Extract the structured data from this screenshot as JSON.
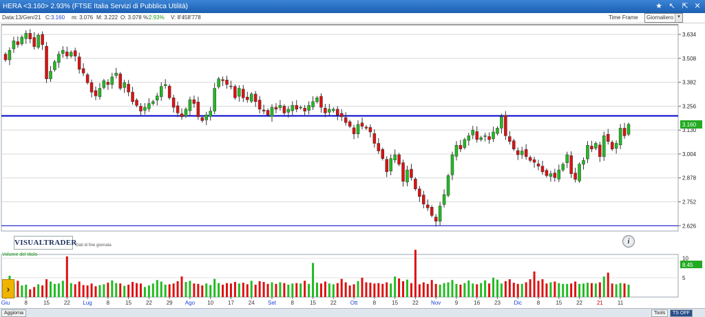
{
  "window": {
    "title": "HERA <3.160> 2.93%  (FTSE Italia Servizi di Pubblica Utilità)",
    "controls": [
      "★",
      "↖",
      "⇱",
      "✕"
    ]
  },
  "infobar": {
    "date": "Data:13/Gen/21",
    "close_label": "C:",
    "close_value": "3.160",
    "min": "m: 3.076",
    "max": "M: 3.222",
    "open": "O: 3.078",
    "pct_label": "%:",
    "pct_value": "2.93%",
    "volume": "V: 8'458'778",
    "timeframe_label": "Time Frame",
    "timeframe_value": "Giornaliero"
  },
  "logo": {
    "text": "VISUALTRADER",
    "subtitle": "Dati di fine giornata"
  },
  "colors": {
    "up": "#22bb22",
    "down": "#dd1111",
    "line": "#0000cc",
    "volume_label": "#1a9a1a"
  },
  "chart_data": {
    "type": "candlestick",
    "title": "HERA",
    "y_ticks": [
      "3.634",
      "3.508",
      "3.382",
      "3.256",
      "3.130",
      "3.004",
      "2.878",
      "2.752",
      "2.626"
    ],
    "ylim": [
      2.598,
      3.685
    ],
    "current_price_label": "3.160",
    "resistance_level": 3.205,
    "lower_level": 2.626,
    "x_labels": [
      "Giu",
      "8",
      "15",
      "22",
      "Lug",
      "8",
      "15",
      "22",
      "29",
      "Ago",
      "10",
      "17",
      "24",
      "Set",
      "8",
      "15",
      "22",
      "Ott",
      "8",
      "15",
      "22",
      "Nov",
      "9",
      "16",
      "23",
      "Dic",
      "8",
      "15",
      "22",
      "21",
      "11"
    ],
    "x_label_colors": [
      "#1a3fd6",
      "#333",
      "#333",
      "#333",
      "#1a3fd6",
      "#333",
      "#333",
      "#333",
      "#333",
      "#1a3fd6",
      "#333",
      "#333",
      "#333",
      "#1a3fd6",
      "#333",
      "#333",
      "#333",
      "#1a3fd6",
      "#333",
      "#333",
      "#333",
      "#1a3fd6",
      "#333",
      "#333",
      "#333",
      "#1a3fd6",
      "#333",
      "#333",
      "#333",
      "#cc0000",
      "#333"
    ],
    "x_label_indices": [
      0,
      5,
      10,
      15,
      20,
      25,
      30,
      35,
      40,
      45,
      50,
      55,
      60,
      65,
      70,
      75,
      80,
      85,
      90,
      95,
      100,
      105,
      110,
      115,
      120,
      125,
      130,
      135,
      140,
      145,
      150
    ],
    "closes": [
      3.5,
      3.55,
      3.6,
      3.58,
      3.62,
      3.64,
      3.61,
      3.57,
      3.63,
      3.58,
      3.4,
      3.44,
      3.49,
      3.53,
      3.55,
      3.52,
      3.54,
      3.52,
      3.45,
      3.43,
      3.38,
      3.33,
      3.31,
      3.35,
      3.39,
      3.37,
      3.41,
      3.43,
      3.35,
      3.38,
      3.33,
      3.28,
      3.26,
      3.23,
      3.25,
      3.27,
      3.28,
      3.31,
      3.36,
      3.37,
      3.3,
      3.25,
      3.22,
      3.2,
      3.24,
      3.29,
      3.27,
      3.2,
      3.18,
      3.21,
      3.23,
      3.35,
      3.4,
      3.39,
      3.37,
      3.36,
      3.3,
      3.35,
      3.3,
      3.29,
      3.32,
      3.28,
      3.24,
      3.23,
      3.21,
      3.25,
      3.24,
      3.26,
      3.22,
      3.24,
      3.26,
      3.24,
      3.25,
      3.23,
      3.26,
      3.28,
      3.3,
      3.25,
      3.22,
      3.24,
      3.24,
      3.21,
      3.2,
      3.17,
      3.15,
      3.11,
      3.16,
      3.15,
      3.14,
      3.12,
      3.06,
      3.02,
      2.98,
      2.91,
      2.98,
      3.0,
      2.95,
      2.86,
      2.92,
      2.88,
      2.82,
      2.78,
      2.74,
      2.72,
      2.68,
      2.65,
      2.73,
      2.79,
      2.89,
      3.0,
      3.05,
      3.03,
      3.08,
      3.1,
      3.13,
      3.08,
      3.09,
      3.1,
      3.08,
      3.12,
      3.14,
      3.2,
      3.1,
      3.07,
      3.03,
      3.0,
      3.02,
      2.99,
      2.97,
      2.96,
      2.94,
      2.91,
      2.89,
      2.9,
      2.88,
      2.92,
      2.95,
      3.0,
      2.9,
      2.87,
      2.95,
      2.97,
      3.05,
      3.03,
      3.06,
      2.99,
      3.1,
      3.07,
      3.03,
      3.06,
      3.14,
      3.1,
      3.16
    ],
    "volume_label": "Volume del titolo",
    "volume_ticks": [
      "10",
      "5"
    ],
    "volume_current_label": "8.45",
    "volume_ymax": 11,
    "volumes": [
      4.5,
      5.5,
      3.8,
      4.2,
      3.0,
      3.2,
      2.0,
      2.6,
      3.3,
      3.0,
      4.6,
      4.0,
      3.4,
      3.5,
      4.2,
      10.5,
      3.6,
      3.3,
      4.0,
      3.1,
      3.0,
      3.5,
      2.8,
      3.1,
      3.3,
      3.7,
      4.3,
      3.6,
      3.5,
      2.9,
      3.2,
      3.9,
      3.6,
      3.5,
      2.6,
      3.0,
      3.5,
      4.4,
      4.0,
      3.2,
      3.3,
      3.5,
      4.1,
      5.3,
      3.9,
      4.2,
      3.5,
      3.4,
      3.0,
      3.5,
      3.1,
      4.7,
      3.6,
      3.2,
      3.6,
      3.5,
      3.9,
      3.5,
      3.7,
      3.3,
      4.2,
      3.2,
      4.1,
      3.9,
      3.4,
      3.8,
      3.4,
      3.8,
      3.6,
      3.2,
      3.5,
      3.6,
      3.5,
      4.2,
      3.4,
      8.8,
      3.7,
      3.5,
      4.0,
      3.5,
      3.3,
      3.6,
      4.7,
      3.8,
      3.0,
      3.3,
      4.1,
      5.0,
      3.8,
      3.7,
      3.5,
      3.6,
      3.4,
      3.8,
      3.5,
      5.3,
      4.8,
      4.1,
      4.5,
      3.6,
      12.2,
      3.3,
      3.8,
      3.4,
      4.4,
      3.4,
      3.2,
      3.6,
      3.8,
      4.4,
      3.4,
      3.2,
      3.6,
      4.3,
      3.5,
      3.3,
      3.6,
      4.3,
      3.5,
      5.0,
      4.5,
      3.5,
      4.1,
      4.6,
      3.7,
      3.4,
      3.4,
      3.8,
      4.6,
      6.6,
      4.2,
      4.6,
      3.5,
      3.8,
      4.0,
      3.6,
      3.4,
      3.4,
      3.5,
      4.0,
      3.4,
      3.5,
      3.7,
      3.6,
      3.5,
      3.8,
      5.3,
      6.3,
      3.5,
      3.3,
      3.6,
      3.5,
      3.2,
      3.5,
      4.7,
      3.9,
      3.6,
      3.9,
      4.2,
      3.4,
      4.7,
      4.3,
      5.0,
      3.4,
      8.5
    ]
  },
  "bottombar": {
    "aggiorna": "Aggiorna",
    "tools": "Tools",
    "ts_off": "TS OFF"
  }
}
